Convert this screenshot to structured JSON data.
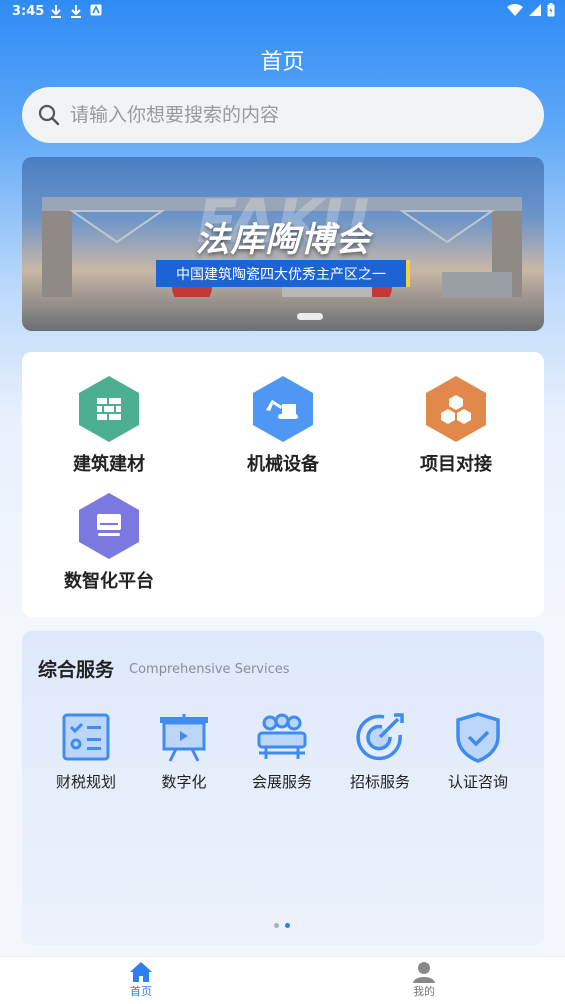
{
  "status_bar": {
    "time": "3:45"
  },
  "header": {
    "title": "首页"
  },
  "search": {
    "placeholder": "请输入你想要搜索的内容"
  },
  "banner": {
    "title": "法库陶博会",
    "ghost_text": "FAKU",
    "subtitle": "中国建筑陶瓷四大优秀主产区之一"
  },
  "categories": [
    {
      "label": "建筑建材",
      "color": "#4caf8f",
      "icon": "brick-wall-icon"
    },
    {
      "label": "机械设备",
      "color": "#4f97f5",
      "icon": "excavator-icon"
    },
    {
      "label": "项目对接",
      "color": "#e0894a",
      "icon": "cubes-icon"
    },
    {
      "label": "数智化平台",
      "color": "#7b78e0",
      "icon": "monitor-icon"
    }
  ],
  "services": {
    "title": "综合服务",
    "subtitle": "Comprehensive Services",
    "items": [
      {
        "label": "财税规划",
        "icon": "checklist-icon"
      },
      {
        "label": "数字化",
        "icon": "presentation-icon"
      },
      {
        "label": "会展服务",
        "icon": "audience-icon"
      },
      {
        "label": "招标服务",
        "icon": "target-icon"
      },
      {
        "label": "认证咨询",
        "icon": "shield-check-icon"
      }
    ]
  },
  "tabs": [
    {
      "label": "首页",
      "icon": "home-icon",
      "active": true
    },
    {
      "label": "我的",
      "icon": "user-icon",
      "active": false
    }
  ],
  "colors": {
    "accent": "#2f7ef0",
    "services_icon": "#3f8bf0"
  }
}
